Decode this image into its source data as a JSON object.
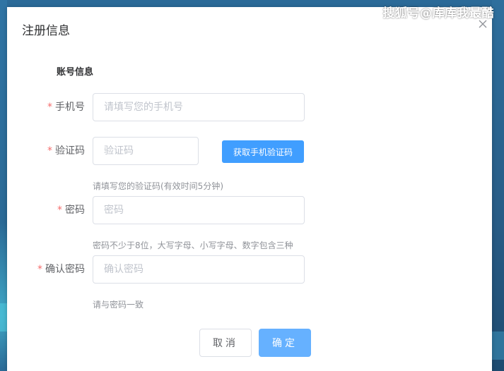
{
  "watermark": "搜狐号@库库我最酷",
  "dialog": {
    "title": "注册信息",
    "close_icon": "close-icon",
    "section_title": "账号信息"
  },
  "form": {
    "required_mark": "*",
    "phone": {
      "label": "手机号",
      "placeholder": "请填写您的手机号",
      "value": ""
    },
    "code": {
      "label": "验证码",
      "placeholder": "验证码",
      "value": "",
      "button_label": "获取手机验证码",
      "hint": "请填写您的验证码(有效时间5分钟)"
    },
    "password": {
      "label": "密码",
      "placeholder": "密码",
      "value": "",
      "hint": "密码不少于8位，大写字母、小写字母、数字包含三种"
    },
    "confirm_password": {
      "label": "确认密码",
      "placeholder": "确认密码",
      "value": "",
      "hint": "请与密码一致"
    }
  },
  "footer": {
    "cancel_label": "取消",
    "confirm_label": "确定"
  },
  "colors": {
    "primary": "#409eff",
    "primary_light": "#66b1ff",
    "required": "#f56c6c",
    "text": "#606266",
    "placeholder": "#c0c4cc",
    "hint": "#909399",
    "border": "#dcdfe6"
  }
}
